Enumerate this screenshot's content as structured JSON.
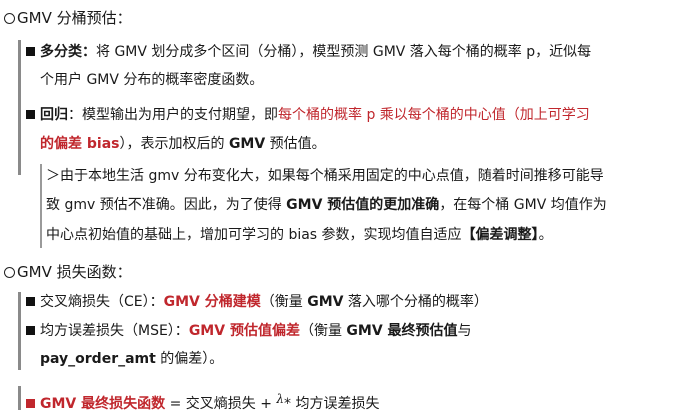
{
  "section1": {
    "title": "GMV 分桶预估："
  },
  "multi_class": {
    "label": "多分类：",
    "line1_text": "将 GMV 划分成多个区间（分桶），模型预测 GMV 落入每个桶的概率 p，近似每",
    "line2_text": "个用户 GMV 分布的概率密度函数。"
  },
  "regression": {
    "label": "回归",
    "line1_plain": "：模型输出为用户的支付期望，即",
    "line1_red": "每个桶的概率 p 乘以每个桶的中心值（加上可学习",
    "line2_red": "的偏差 bias",
    "line2_plain_a": "），表示加权后的 ",
    "line2_bold": "GMV",
    "line2_plain_b": " 预估值。"
  },
  "note": {
    "line1": "＞由于本地生活 gmv 分布变化大，如果每个桶采用固定的中心点值，随着时间推移可能导",
    "line2_a": "致 gmv 预估不准确。因此，为了使得 ",
    "line2_bold": "GMV 预估值的更加准确",
    "line2_b": "，在每个桶 GMV 均值作为",
    "line3_a": "中心点初始值的基础上，增加可学习的 bias 参数，实现均值自适应",
    "line3_bold": "【偏差调整】",
    "line3_b": "。"
  },
  "section2": {
    "title": "GMV 损失函数："
  },
  "ce_loss": {
    "label": "交叉熵损失（CE）：",
    "red_bold": "GMV 分桶建模",
    "desc_a": "（衡量 ",
    "desc_bold": "GMV",
    "desc_b": " 落入哪个分桶的概率）"
  },
  "mse_loss": {
    "label": "均方误差损失（MSE）：",
    "red_bold": "GMV 预估值偏差",
    "desc_a": "（衡量 ",
    "desc_bold": "GMV 最终预估值",
    "desc_b": "与",
    "line2_bold": "pay_order_amt",
    "line2_plain": " 的偏差）。"
  },
  "final_loss": {
    "red_bold": "GMV 最终损失函数",
    "eq": " = 交叉熵损失 + ",
    "lambda": "λ",
    "tail": "* 均方误差损失"
  },
  "colors": {
    "accent_red": "#c0272d",
    "bar_gray": "#8a8a8a"
  }
}
